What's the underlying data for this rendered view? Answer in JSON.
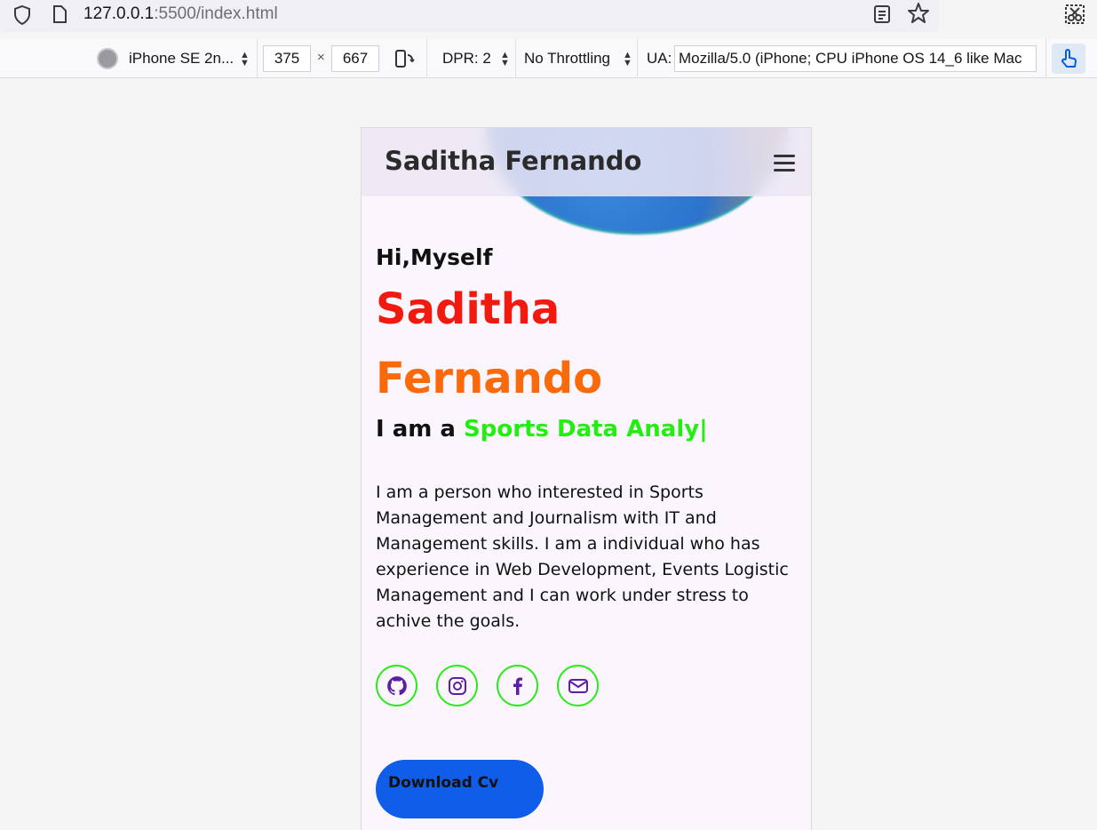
{
  "browser": {
    "url_host": "127.0.0.1",
    "url_path": ":5500/index.html"
  },
  "rdm": {
    "device": "iPhone SE 2n...",
    "width": "375",
    "times": "×",
    "height": "667",
    "dpr": "DPR: 2",
    "throttling": "No Throttling",
    "ua_label": "UA:",
    "ua_value": "Mozilla/5.0 (iPhone; CPU iPhone OS 14_6 like Mac"
  },
  "site": {
    "brand": "Saditha Fernando",
    "greeting": "Hi,Myself",
    "first_name": "Saditha",
    "last_name": "Fernando",
    "iam_prefix": "I am a ",
    "role": "Sports Data Analy|",
    "bio": "I am a person who interested in Sports Management and Journalism with IT and Management skills. I am a individual who has experience in Web Development, Events Logistic Management and I can work under stress to achive the goals.",
    "download_label": "Download Cv",
    "socials": [
      "github-icon",
      "instagram-icon",
      "facebook-icon",
      "mail-icon"
    ]
  },
  "colors": {
    "first_name": "#f11a0e",
    "last_name": "#fb6a0a",
    "role": "#22ee10",
    "button": "#0f5de8",
    "social_border": "#2bea1a",
    "icon": "#5b1fa3"
  }
}
